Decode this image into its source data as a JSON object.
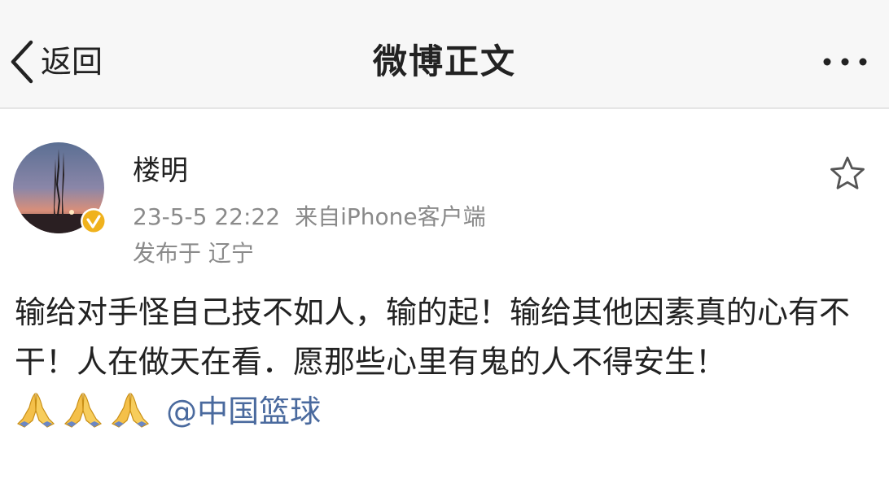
{
  "navbar": {
    "back_label": "返回",
    "title": "微博正文",
    "more_icon": "more-dots-icon"
  },
  "post": {
    "author": "楼明",
    "timestamp": "23-5-5 22:22",
    "source": "来自iPhone客户端",
    "location": "发布于 辽宁",
    "verified_badge_color": "#f0b21d",
    "text_main": "输给对手怪自己技不如人，输的起！输给其他因素真的心有不干！人在做天在看．愿那些心里有鬼的人不得安生！",
    "emoji": "praying-hands-icon",
    "emoji_count": 3,
    "mention": "@中国篮球",
    "mention_color": "#4a6a9e"
  }
}
